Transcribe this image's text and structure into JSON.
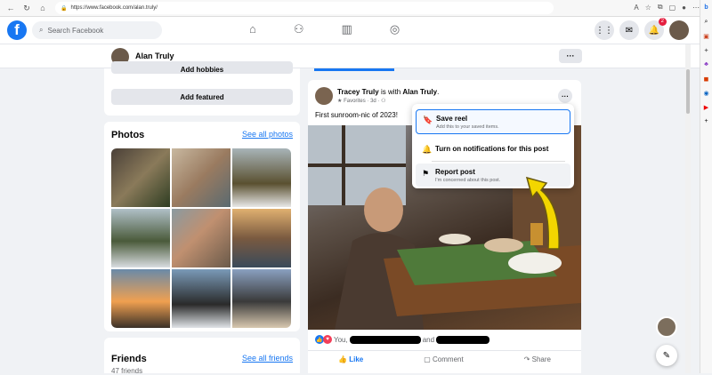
{
  "browser": {
    "url": "https://www.facebook.com/alan.truly/"
  },
  "facebook": {
    "search_placeholder": "Search Facebook",
    "notification_count": "2"
  },
  "profile": {
    "name": "Alan Truly",
    "more_label": "···"
  },
  "left": {
    "add_hobbies": "Add hobbies",
    "add_featured": "Add featured",
    "photos_title": "Photos",
    "see_all_photos": "See all photos",
    "friends_title": "Friends",
    "friends_count": "47 friends",
    "see_all_friends": "See all friends"
  },
  "post": {
    "author": "Tracey Truly",
    "with_text": "is with",
    "tagged": "Alan Truly",
    "time": "3d",
    "audience": "Favorites",
    "text": "First sunroom-nic of 2023!",
    "reactions_prefix": "You,",
    "reactions_and": "and",
    "like": "Like",
    "comment": "Comment",
    "share": "Share"
  },
  "menu": {
    "save_title": "Save reel",
    "save_sub": "Add this to your saved items.",
    "notif_title": "Turn on notifications for this post",
    "report_title": "Report post",
    "report_sub": "I'm concerned about this post."
  },
  "colors": {
    "brand": "#1877f2",
    "badge": "#e41e3f",
    "arrow": "#f2d600"
  }
}
